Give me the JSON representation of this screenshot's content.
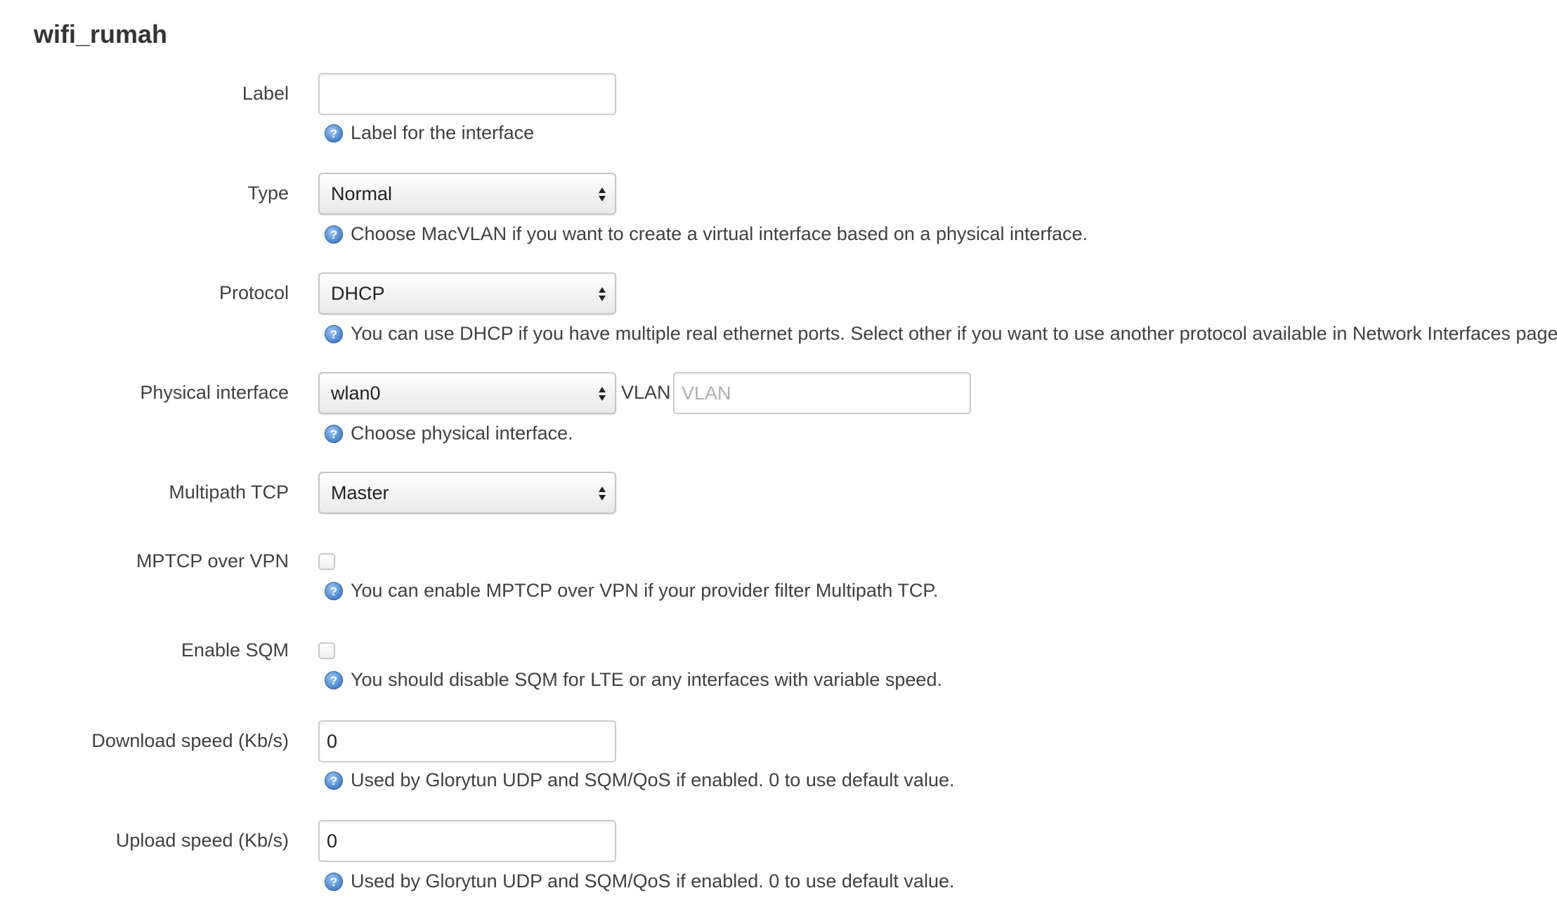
{
  "section": {
    "title": "wifi_rumah"
  },
  "fields": {
    "label": {
      "label": "Label",
      "value": "",
      "help": "Label for the interface"
    },
    "type": {
      "label": "Type",
      "selected": "Normal",
      "help": "Choose MacVLAN if you want to create a virtual interface based on a physical interface."
    },
    "protocol": {
      "label": "Protocol",
      "selected": "DHCP",
      "help": "You can use DHCP if you have multiple real ethernet ports. Select other if you want to use another protocol available in Network Interfaces page."
    },
    "physical": {
      "label": "Physical interface",
      "selected": "wlan0",
      "vlan_label": "VLAN",
      "vlan_placeholder": "VLAN",
      "help": "Choose physical interface."
    },
    "multipath": {
      "label": "Multipath TCP",
      "selected": "Master"
    },
    "mptcp_vpn": {
      "label": "MPTCP over VPN",
      "checked": false,
      "help": "You can enable MPTCP over VPN if your provider filter Multipath TCP."
    },
    "sqm": {
      "label": "Enable SQM",
      "checked": false,
      "help": "You should disable SQM for LTE or any interfaces with variable speed."
    },
    "download": {
      "label": "Download speed (Kb/s)",
      "value": "0",
      "help": "Used by Glorytun UDP and SQM/QoS if enabled. 0 to use default value."
    },
    "upload": {
      "label": "Upload speed (Kb/s)",
      "value": "0",
      "help": "Used by Glorytun UDP and SQM/QoS if enabled. 0 to use default value."
    }
  },
  "icons": {
    "help": "help-question-icon",
    "select": "select-updown-arrows-icon"
  },
  "colors": {
    "help_icon": "#4f8fd6",
    "text": "#404040",
    "title": "#333333"
  }
}
